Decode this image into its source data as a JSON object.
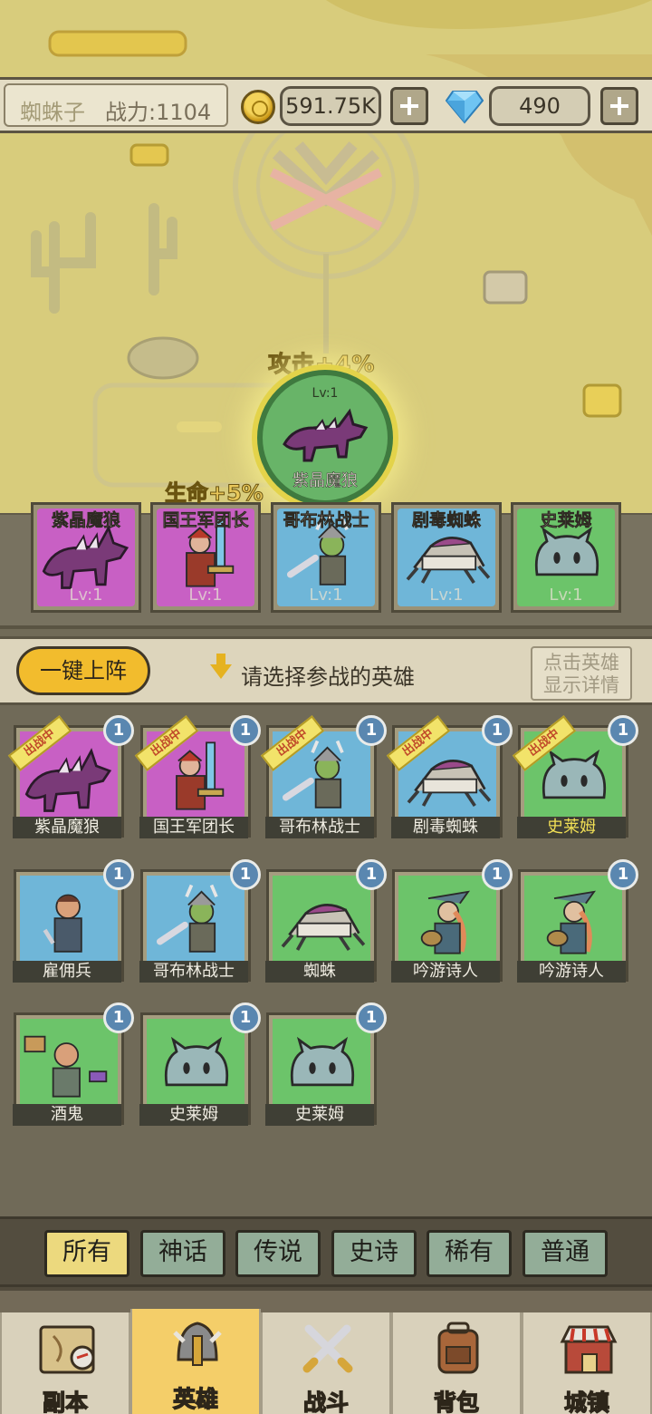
{
  "player": {
    "name": "蜘蛛子",
    "power_label": "战力:1104"
  },
  "currency": {
    "gold": "591.75K",
    "gems": "490"
  },
  "focus_hero": {
    "level": "Lv:1",
    "name": "紫晶魔狼",
    "bonus_attack": "攻击+4%",
    "bonus_hp": "生命+5%"
  },
  "team": [
    {
      "name": "紫晶魔狼",
      "level": "Lv:1",
      "rarity": "mythic",
      "portrait": "wolf-portrait"
    },
    {
      "name": "国王军团长",
      "level": "Lv:1",
      "rarity": "mythic",
      "portrait": "knight-portrait"
    },
    {
      "name": "哥布林战士",
      "level": "Lv:1",
      "rarity": "legendary",
      "portrait": "goblin-portrait"
    },
    {
      "name": "剧毒蜘蛛",
      "level": "Lv:1",
      "rarity": "legendary",
      "portrait": "spider-portrait"
    },
    {
      "name": "史莱姆",
      "level": "Lv:1",
      "rarity": "rare",
      "portrait": "slime-portrait"
    }
  ],
  "actions": {
    "deploy_all": "一键上阵",
    "hint": "请选择参战的英雄",
    "detail_line1": "点击英雄",
    "detail_line2": "显示详情"
  },
  "roster": [
    {
      "name": "紫晶魔狼",
      "count": "1",
      "deployed": true,
      "tag": "出战中",
      "rarity": "mythic",
      "portrait": "wolf-portrait"
    },
    {
      "name": "国王军团长",
      "count": "1",
      "deployed": true,
      "tag": "出战中",
      "rarity": "mythic",
      "portrait": "knight-portrait"
    },
    {
      "name": "哥布林战士",
      "count": "1",
      "deployed": true,
      "tag": "出战中",
      "rarity": "legendary",
      "portrait": "goblin-portrait"
    },
    {
      "name": "剧毒蜘蛛",
      "count": "1",
      "deployed": true,
      "tag": "出战中",
      "rarity": "legendary",
      "portrait": "spider-portrait"
    },
    {
      "name": "史莱姆",
      "count": "1",
      "deployed": true,
      "tag": "出战中",
      "rarity": "rare",
      "portrait": "slime-portrait",
      "highlight": true
    },
    {
      "name": "雇佣兵",
      "count": "1",
      "deployed": false,
      "rarity": "legendary",
      "portrait": "mercenary-portrait"
    },
    {
      "name": "哥布林战士",
      "count": "1",
      "deployed": false,
      "rarity": "legendary",
      "portrait": "goblin-portrait"
    },
    {
      "name": "蜘蛛",
      "count": "1",
      "deployed": false,
      "rarity": "rare",
      "portrait": "spider-portrait"
    },
    {
      "name": "吟游诗人",
      "count": "1",
      "deployed": false,
      "rarity": "rare",
      "portrait": "bard-portrait"
    },
    {
      "name": "吟游诗人",
      "count": "1",
      "deployed": false,
      "rarity": "rare",
      "portrait": "bard-portrait"
    },
    {
      "name": "酒鬼",
      "count": "1",
      "deployed": false,
      "rarity": "rare",
      "portrait": "drunkard-portrait"
    },
    {
      "name": "史莱姆",
      "count": "1",
      "deployed": false,
      "rarity": "rare",
      "portrait": "slime-portrait"
    },
    {
      "name": "史莱姆",
      "count": "1",
      "deployed": false,
      "rarity": "rare",
      "portrait": "slime-portrait"
    }
  ],
  "filters": [
    {
      "label": "所有",
      "active": true
    },
    {
      "label": "神话",
      "active": false
    },
    {
      "label": "传说",
      "active": false
    },
    {
      "label": "史诗",
      "active": false
    },
    {
      "label": "稀有",
      "active": false
    },
    {
      "label": "普通",
      "active": false
    }
  ],
  "nav": [
    {
      "label": "副本",
      "icon": "map-icon",
      "active": false
    },
    {
      "label": "英雄",
      "icon": "helmet-icon",
      "active": true
    },
    {
      "label": "战斗",
      "icon": "crossed-swords-icon",
      "active": false
    },
    {
      "label": "背包",
      "icon": "backpack-icon",
      "active": false
    },
    {
      "label": "城镇",
      "icon": "shop-icon",
      "active": false
    }
  ],
  "colors": {
    "mythic": "#c860c4",
    "legendary": "#6fb6d8",
    "rare": "#6cc46a",
    "accent": "#f2bc2d",
    "active_tab": "#ecd97e"
  }
}
